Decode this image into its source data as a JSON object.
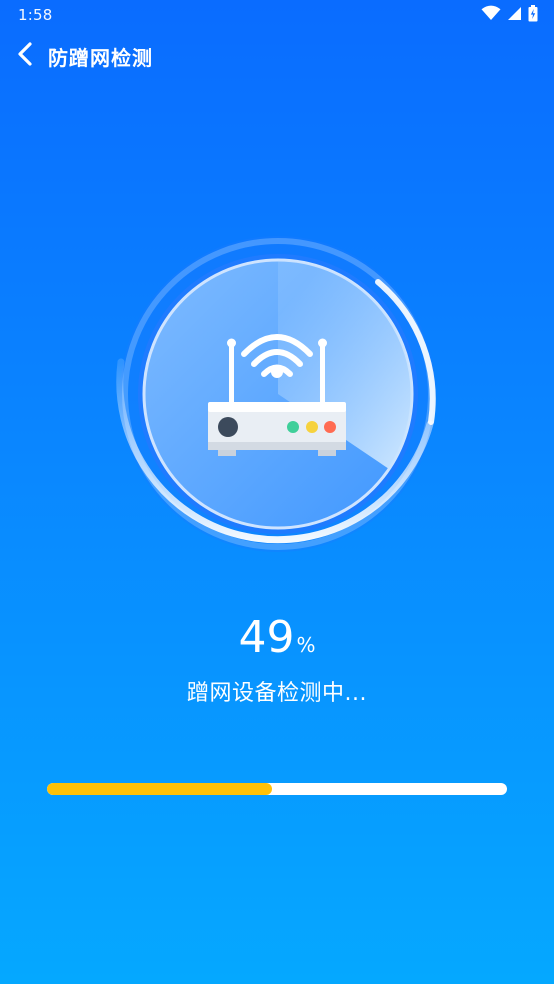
{
  "status_bar": {
    "time": "1:58",
    "icons": [
      "wifi-icon",
      "cellular-signal-icon",
      "battery-icon"
    ]
  },
  "header": {
    "title": "防蹭网检测",
    "back_icon": "chevron-left-icon"
  },
  "scan": {
    "icon": "router-icon",
    "percent": "49",
    "percent_sign": "%",
    "status": "蹭网设备检测中..."
  },
  "progress": {
    "fraction": 0.49
  },
  "colors": {
    "background_top": "#0A6CFF",
    "background_bottom": "#05A8FF",
    "progress_fill": "#FFC107",
    "progress_track": "#FFFFFF",
    "router_led_green": "#3FCF9A",
    "router_led_yellow": "#F6D23E",
    "router_led_red": "#FF6B52"
  }
}
